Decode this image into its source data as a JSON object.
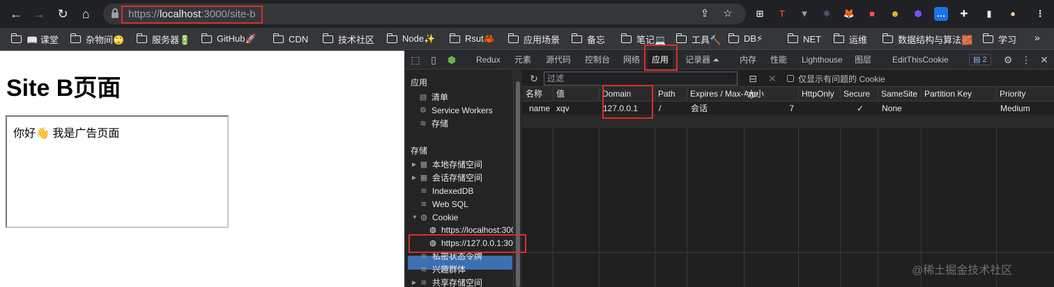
{
  "browser": {
    "url": {
      "scheme": "https://",
      "host": "localhost",
      "path": ":3000/site-b"
    },
    "nav_icons": [
      "back-arrow-icon",
      "forward-arrow-icon",
      "reload-icon",
      "home-icon"
    ],
    "omnibox_icons": [
      "share-icon",
      "star-icon"
    ],
    "extensions": [
      {
        "name": "grid-apps-icon",
        "glyph": "⊞",
        "color": "#e8eaed",
        "bg": "transparent"
      },
      {
        "name": "t-extension-icon",
        "glyph": "T",
        "color": "#e53935",
        "bg": "transparent"
      },
      {
        "name": "vue-devtools-icon",
        "glyph": "▼",
        "color": "#9aa0a6",
        "bg": "transparent"
      },
      {
        "name": "react-devtools-icon",
        "glyph": "⚛",
        "color": "#8ab4f8",
        "bg": "transparent"
      },
      {
        "name": "metamask-fox-icon",
        "glyph": "🦊",
        "color": "#f6851b",
        "bg": "transparent"
      },
      {
        "name": "extension-red-icon",
        "glyph": "■",
        "color": "#ff4f4f",
        "bg": "transparent"
      },
      {
        "name": "avatar-extension-icon",
        "glyph": "☻",
        "color": "#f3c623",
        "bg": "transparent"
      },
      {
        "name": "hexagon-extension-icon",
        "glyph": "⬢",
        "color": "#7c4dff",
        "bg": "transparent"
      },
      {
        "name": "chat-extension-icon",
        "glyph": "…",
        "color": "#ffffff",
        "bg": "#1a73e8"
      },
      {
        "name": "puzzle-extensions-icon",
        "glyph": "✚",
        "color": "#e8eaed",
        "bg": "transparent"
      },
      {
        "name": "sidepanel-icon",
        "glyph": "▮",
        "color": "#e8eaed",
        "bg": "transparent"
      },
      {
        "name": "profile-avatar-icon",
        "glyph": "●",
        "color": "#e8c9a0",
        "bg": "transparent"
      },
      {
        "name": "menu-kebab-icon",
        "glyph": "⋮",
        "color": "#e8eaed",
        "bg": "transparent"
      }
    ]
  },
  "bookmarks": [
    "📖 课堂",
    "杂物间🙄",
    "服务器🔋",
    "GitHub🚀",
    "CDN",
    "技术社区",
    "Node✨",
    "Rsut🦀",
    "应用场景",
    "备忘",
    "笔记💻",
    "工具🔨",
    "DB⚡",
    "NET",
    "运维",
    "数据结构与算法🧱",
    "学习"
  ],
  "bookmarks_more": "»",
  "page": {
    "title": "Site B页面",
    "iframe_text": "你好👋 我是广告页面"
  },
  "devtools": {
    "tabs": [
      "Redux",
      "元素",
      "源代码",
      "控制台",
      "网络",
      "应用",
      "记录器 ⏶",
      "内存",
      "性能",
      "Lighthouse",
      "图层",
      "EditThisCookie"
    ],
    "active_tab": "应用",
    "issues_count": "2",
    "sidebar": {
      "app_header": "应用",
      "app_items": [
        {
          "label": "清单",
          "icon": "file-icon"
        },
        {
          "label": "Service Workers",
          "icon": "gear-icon"
        },
        {
          "label": "存储",
          "icon": "database-icon"
        }
      ],
      "storage_header": "存储",
      "storage_items": [
        {
          "label": "本地存储空间",
          "icon": "grid-icon",
          "expander": "▶"
        },
        {
          "label": "会话存储空间",
          "icon": "grid-icon",
          "expander": "▶"
        },
        {
          "label": "IndexedDB",
          "icon": "database-icon",
          "expander": ""
        },
        {
          "label": "Web SQL",
          "icon": "database-icon",
          "expander": ""
        },
        {
          "label": "Cookie",
          "icon": "cookie-icon",
          "expander": "▼"
        }
      ],
      "cookie_items": [
        "https://localhost:300",
        "https://127.0.0.1:300"
      ],
      "more_items": [
        {
          "label": "私密状态令牌",
          "icon": "database-icon",
          "expander": ""
        },
        {
          "label": "兴趣群体",
          "icon": "database-icon",
          "expander": ""
        },
        {
          "label": "共享存储空间",
          "icon": "database-icon",
          "expander": "▶"
        }
      ]
    },
    "cookies": {
      "filter_placeholder": "过滤",
      "only_issues_label": "仅显示有问题的 Cookie",
      "columns": [
        "名称",
        "值",
        "Domain",
        "Path",
        "Expires / Max-Age",
        "大小",
        "HttpOnly",
        "Secure",
        "SameSite",
        "Partition Key",
        "Priority"
      ],
      "rows": [
        {
          "name": "name",
          "value": "xqv",
          "domain": "127.0.0.1",
          "path": "/",
          "expires": "会话",
          "size": "7",
          "httponly": "",
          "secure": "✓",
          "samesite": "None",
          "partition": "",
          "priority": "Medium"
        }
      ]
    }
  },
  "watermark": "@稀土掘金技术社区",
  "colors": {
    "highlight": "#d93025",
    "selected": "#3e6fb0"
  }
}
